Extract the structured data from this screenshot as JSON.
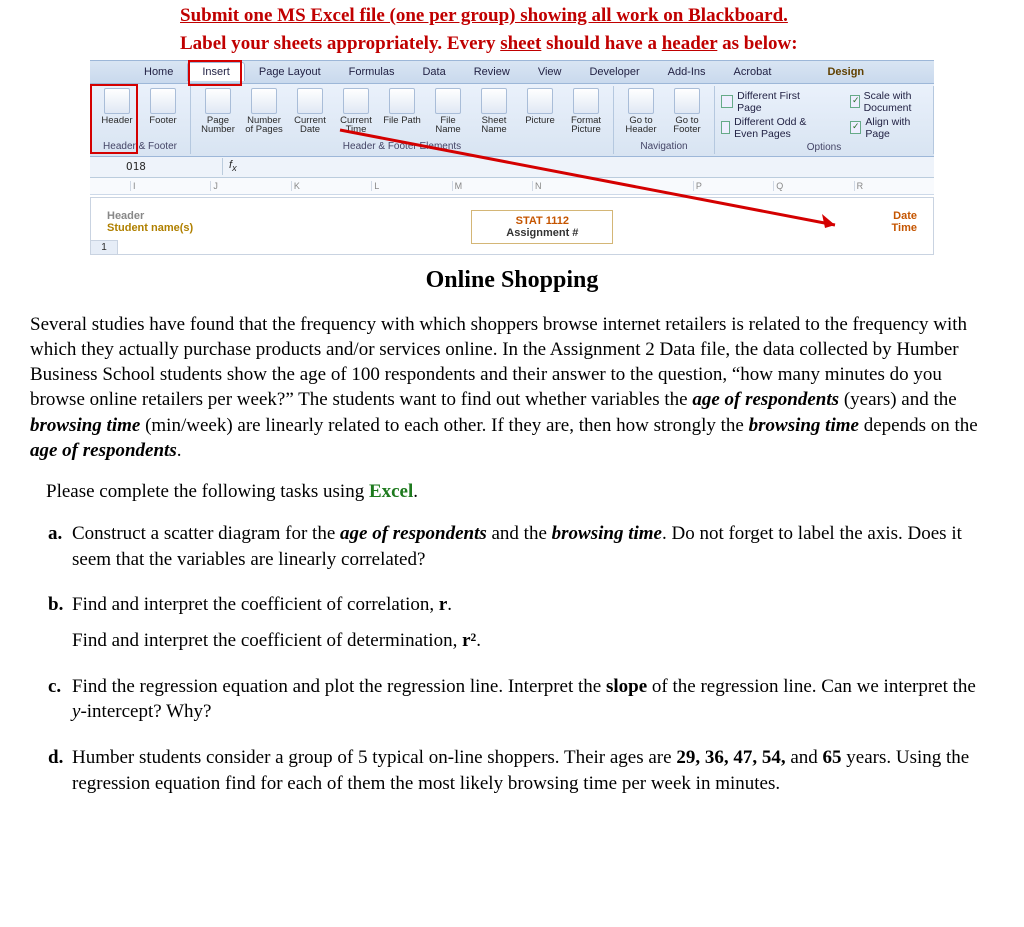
{
  "instructions": {
    "line1_a": "Submit one MS Excel file (one per group) showing all work on Blackboard.",
    "line2_a": "Label your sheets appropriately. Every ",
    "line2_u": "sheet",
    "line2_b": " should have a ",
    "line2_u2": "header",
    "line2_c": " as below:"
  },
  "excel": {
    "tabs": [
      "Home",
      "Insert",
      "Page Layout",
      "Formulas",
      "Data",
      "Review",
      "View",
      "Developer",
      "Add-Ins",
      "Acrobat",
      "Design"
    ],
    "active_tab": "Insert",
    "groups": {
      "g1": {
        "btns": [
          "Header",
          "Footer"
        ],
        "label": "Header & Footer"
      },
      "g2": {
        "btns": [
          "Page Number",
          "Number of Pages",
          "Current Date",
          "Current Time",
          "File Path",
          "File Name",
          "Sheet Name",
          "Picture",
          "Format Picture"
        ],
        "label": "Header & Footer Elements"
      },
      "g3": {
        "btns": [
          "Go to Header",
          "Go to Footer"
        ],
        "label": "Navigation"
      },
      "opts": {
        "o1": "Different First Page",
        "o2": "Different Odd & Even Pages",
        "o3": "Scale with Document",
        "o4": "Align with Page",
        "label": "Options"
      }
    },
    "namebox": "O18",
    "cols": [
      "I",
      "J",
      "K",
      "L",
      "M",
      "N",
      "",
      "P",
      "Q",
      "R"
    ],
    "header_block": {
      "left_top": "Header",
      "left": "Student name(s)",
      "center_top": "STAT 1112",
      "center_bot": "Assignment #",
      "right_top": "Date",
      "right_bot": "Time"
    },
    "rownum": "1"
  },
  "doc": {
    "title": "Online Shopping",
    "para": "Several studies have found that the frequency with which shoppers browse internet retailers is related to the frequency with which they actually purchase products and/or services online. In the Assignment 2 Data file, the data collected by Humber Business School students show the age of 100 respondents and their answer to the question, “how many minutes do you browse online retailers per week?” The students want to find out whether variables the ",
    "em1": "age of respondents",
    "para_b": " (years) and the ",
    "em2": "browsing time",
    "para_c": " (min/week) are linearly related to each other. If they are, then how strongly the ",
    "em3": "browsing time",
    "para_d": " depends on the ",
    "em4": "age of respondents",
    "para_e": ".",
    "please": "Please complete the following tasks using ",
    "excel_word": "Excel",
    "items": {
      "a": {
        "lab": "a.",
        "t1": "Construct a scatter diagram for the ",
        "e1": "age of respondents",
        "t2": " and the ",
        "e2": "browsing time",
        "t3": ". Do not forget to label the axis. Does it seem that the variables are linearly correlated?"
      },
      "b": {
        "lab": "b.",
        "t1": "Find and interpret the coefficient of correlation, ",
        "r": "r",
        "t2": ".",
        "t3": "Find and interpret the coefficient of determination, ",
        "r2": "r²",
        "t4": "."
      },
      "c": {
        "lab": "c.",
        "t1": "Find the regression equation and plot the regression line. Interpret the ",
        "slope": "slope",
        "t2": " of the regression line. Can we interpret the ",
        "yint": "y",
        "t3": "-intercept? Why?"
      },
      "d": {
        "lab": "d.",
        "t1": "Humber students consider a group of 5 typical on-line shoppers. Their ages are ",
        "ages": "29, 36, 47, 54,",
        "and": " and ",
        "age5": "65",
        "t2": " years. Using the regression equation find for each of them the most likely browsing time per week in minutes."
      }
    }
  }
}
